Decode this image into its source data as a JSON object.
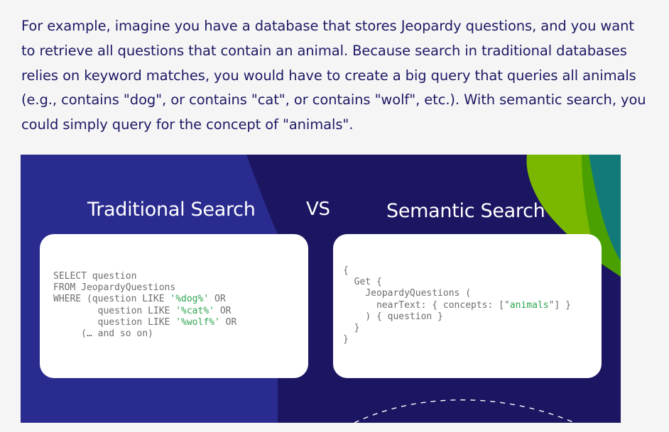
{
  "intro": {
    "paragraph": "For example, imagine you have a database that stores Jeopardy questions, and you want to retrieve all questions that contain an animal. Because search in traditional databases relies on keyword matches, you would have to create a big query that queries all animals (e.g., contains \"dog\", or contains \"cat\", or contains \"wolf\", etc.). With semantic search, you could simply query for the concept of \"animals\"."
  },
  "figure": {
    "left_title": "Traditional Search",
    "vs_label": "VS",
    "right_title": "Semantic Search",
    "sql": {
      "line1": "SELECT question",
      "line2": "FROM JeopardyQuestions",
      "line3_prefix": "WHERE (question LIKE ",
      "line3_string": "'%dog%'",
      "line3_suffix": " OR",
      "line4_prefix": "question LIKE ",
      "line4_string": "'%cat%'",
      "line4_suffix": " OR",
      "line5_prefix": "question LIKE ",
      "line5_string": "'%wolf%'",
      "line5_suffix": " OR",
      "line6": "(… and so on)"
    },
    "graphql": {
      "line1": "{",
      "line2": "Get {",
      "line3": "JeopardyQuestions (",
      "line4_prefix": "nearText: { concepts: [\"",
      "line4_string": "animals",
      "line4_suffix": "\"] }",
      "line5": ") { question }",
      "line6": "}",
      "line7": "}"
    },
    "colors": {
      "background": "#1c1562",
      "accent_blue": "#2a2b8e",
      "accent_green": "#7ab800",
      "accent_teal": "#127a78",
      "code_string": "#2ea44f"
    }
  }
}
